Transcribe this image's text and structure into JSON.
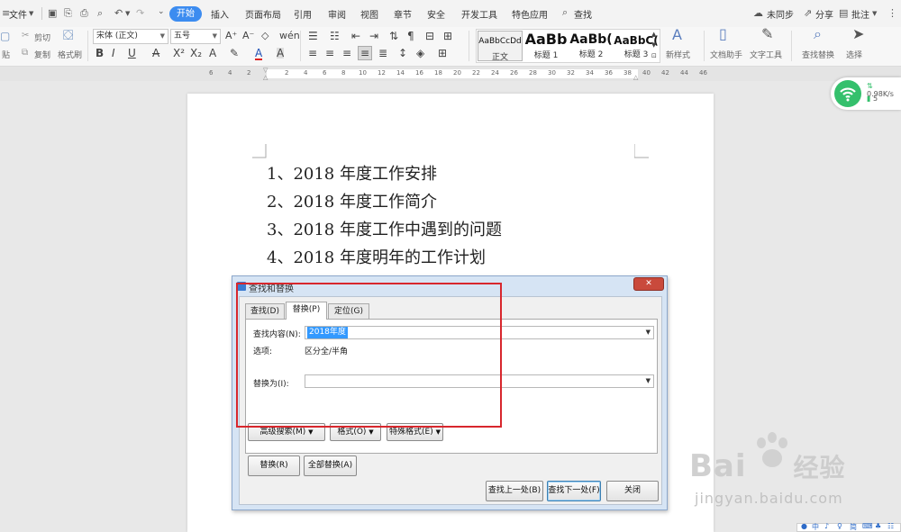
{
  "menubar": {
    "file": "文件",
    "tabs": [
      {
        "label": "插入",
        "name": "tab-insert"
      },
      {
        "label": "页面布局",
        "name": "tab-page-layout"
      },
      {
        "label": "引用",
        "name": "tab-references"
      },
      {
        "label": "审阅",
        "name": "tab-review"
      },
      {
        "label": "视图",
        "name": "tab-view"
      },
      {
        "label": "章节",
        "name": "tab-section"
      },
      {
        "label": "安全",
        "name": "tab-security"
      },
      {
        "label": "开发工具",
        "name": "tab-developer"
      },
      {
        "label": "特色应用",
        "name": "tab-special-apps"
      }
    ],
    "active_tab": "开始",
    "search": "查找",
    "sync": "未同步",
    "share": "分享",
    "comment": "批注"
  },
  "ribbon": {
    "cut": "剪切",
    "copy": "复制",
    "paste_fragment": "贴",
    "format_painter": "格式刷",
    "font_name": "宋体 (正文)",
    "font_size": "五号",
    "styles": [
      {
        "sample": "AaBbCcDd",
        "name": "正文"
      },
      {
        "sample": "AaBb",
        "name": "标题 1"
      },
      {
        "sample": "AaBb(",
        "name": "标题 2"
      },
      {
        "sample": "AaBbC(",
        "name": "标题 3"
      }
    ],
    "new_style": "新样式",
    "doc_assistant": "文档助手",
    "text_tools": "文字工具",
    "find_replace": "查找替换",
    "select": "选择"
  },
  "ruler": {
    "numbers": [
      "6",
      "4",
      "2",
      "2",
      "4",
      "6",
      "8",
      "10",
      "12",
      "14",
      "16",
      "18",
      "20",
      "22",
      "24",
      "26",
      "28",
      "30",
      "32",
      "34",
      "36",
      "38",
      "40",
      "42",
      "44",
      "46"
    ]
  },
  "document": {
    "lines": [
      "1、2018 年度工作安排",
      "2、2018 年度工作简介",
      "3、2018 年度工作中遇到的问题",
      "4、2018 年度明年的工作计划"
    ]
  },
  "network": {
    "speed": "0.98K/s",
    "count": "5",
    "color": "#34c06c"
  },
  "dialog": {
    "title": "查找和替换",
    "tabs": [
      "查找(D)",
      "替换(P)",
      "定位(G)"
    ],
    "active_tab_index": 1,
    "find_label": "查找内容(N):",
    "find_value": "2018年度",
    "options_label": "选项:",
    "options_value": "区分全/半角",
    "replace_label": "替换为(I):",
    "replace_value": "",
    "buttons": {
      "advanced": "高级搜索(M)",
      "format": "格式(O)",
      "special": "特殊格式(E)",
      "replace": "替换(R)",
      "replace_all": "全部替换(A)",
      "find_prev": "查找上一处(B)",
      "find_next": "查找下一处(F)",
      "close": "关闭"
    },
    "highlight_color": "#d8272d"
  },
  "watermark": {
    "text": "Bai",
    "text2": "经验",
    "sub": "jingyan.baidu.com"
  },
  "ime": {
    "items": [
      "中",
      "♪",
      "简"
    ]
  }
}
